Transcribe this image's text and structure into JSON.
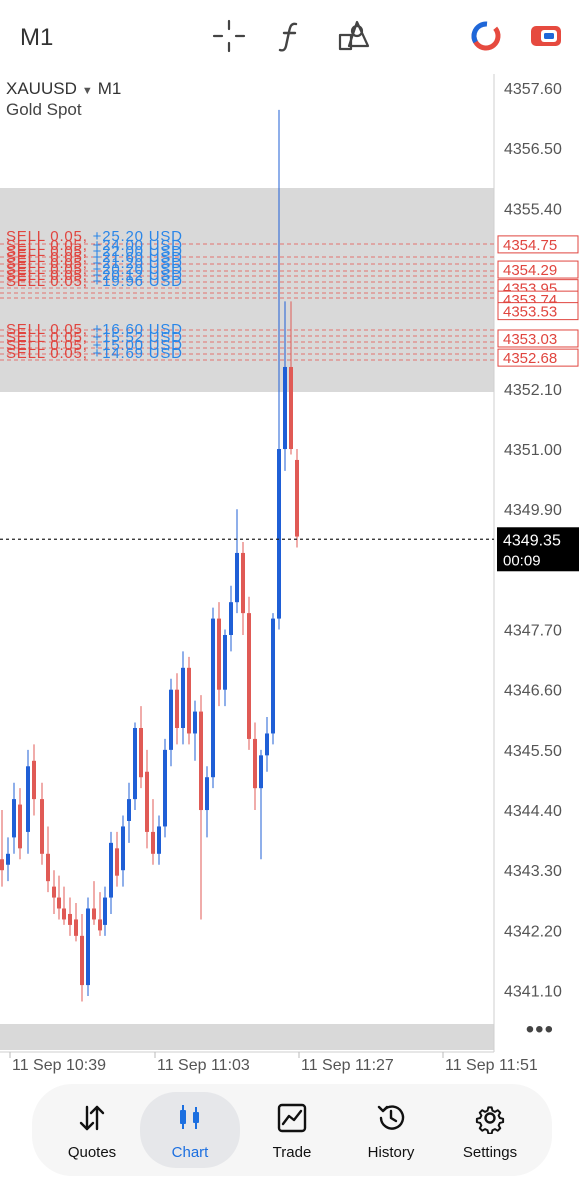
{
  "header": {
    "timeframe": "M1",
    "icons": [
      "crosshair-icon",
      "function-icon",
      "objects-icon",
      "one-click-trading-icon",
      "trade-toggle-icon"
    ]
  },
  "chart": {
    "symbol": "XAUUSD",
    "timeframe": "M1",
    "description": "Gold Spot",
    "current_price": "4349.35",
    "countdown": "00:09",
    "price_axis": [
      "4357.60",
      "4356.50",
      "4355.40",
      "4352.10",
      "4351.00",
      "4349.90",
      "4347.70",
      "4346.60",
      "4345.50",
      "4344.40",
      "4343.30",
      "4342.20",
      "4341.10"
    ],
    "time_axis": [
      "11 Sep 10:39",
      "11 Sep 11:03",
      "11 Sep 11:27",
      "11 Sep 11:51"
    ],
    "position_labels": [
      "SELL 0.05, +25.20 USD",
      "SELL 0.05, +24.00 USD",
      "SELL 0.05, +22.00 USD",
      "SELL 0.05, +21.60 USD",
      "SELL 0.05, +21.20 USD",
      "SELL 0.05, +20.20 USD",
      "SELL 0.05, +20.12 USD",
      "SELL 0.05, +19.96 USD",
      "SELL 0.05, +16.60 USD",
      "SELL 0.05, +15.52 USD",
      "SELL 0.05, +15.00 USD",
      "SELL 0.05, +14.69 USD"
    ],
    "position_prices": [
      "4354.75",
      "4354.29",
      "4353.95",
      "4353.74",
      "4353.53",
      "4353.03",
      "4352.68"
    ],
    "colors": {
      "bull": "#1f5fd6",
      "bear": "#e05a55",
      "zone": "#d9d9d9",
      "profit_text": "#2a86e8",
      "sell_text": "#e0453f"
    }
  },
  "nav": {
    "items": [
      {
        "label": "Quotes",
        "icon": "quotes-icon"
      },
      {
        "label": "Chart",
        "icon": "chart-icon"
      },
      {
        "label": "Trade",
        "icon": "trade-icon"
      },
      {
        "label": "History",
        "icon": "history-icon"
      },
      {
        "label": "Settings",
        "icon": "settings-icon"
      }
    ],
    "active": "Chart"
  }
}
